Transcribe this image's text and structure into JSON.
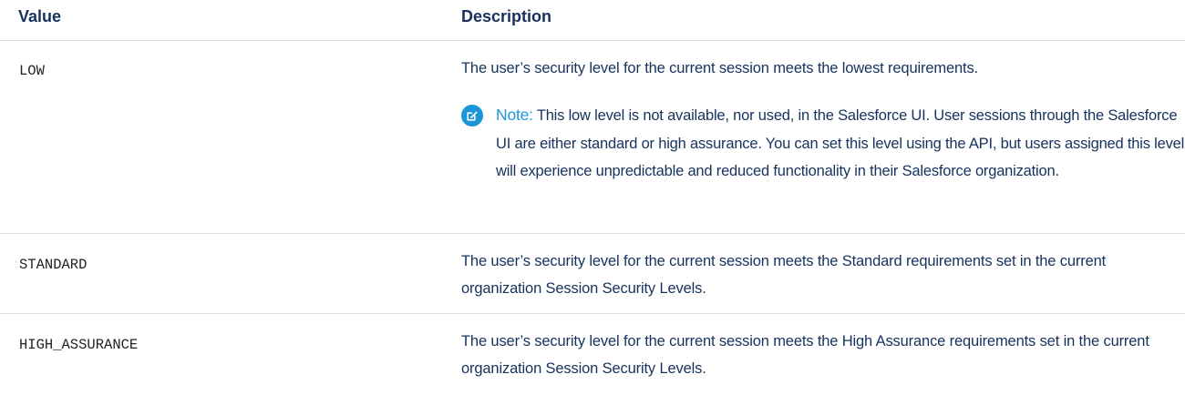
{
  "table": {
    "headers": {
      "value": "Value",
      "description": "Description"
    },
    "rows": [
      {
        "value": "LOW",
        "description": "The user’s security level for the current session meets the lowest requirements.",
        "note": {
          "label": "Note:",
          "text": "This low level is not available, nor used, in the Salesforce UI. User sessions through the Salesforce UI are either standard or high assurance. You can set this level using the API, but users assigned this level will experience unpredictable and reduced functionality in their Salesforce organization.",
          "icon": "edit-note-icon",
          "color": "#1b96d9"
        }
      },
      {
        "value": "STANDARD",
        "description": "The user’s security level for the current session meets the Standard requirements set in the current organization Session Security Levels."
      },
      {
        "value": "HIGH_ASSURANCE",
        "description": "The user’s security level for the current session meets the High Assurance requirements set in the current organization Session Security Levels."
      }
    ]
  }
}
